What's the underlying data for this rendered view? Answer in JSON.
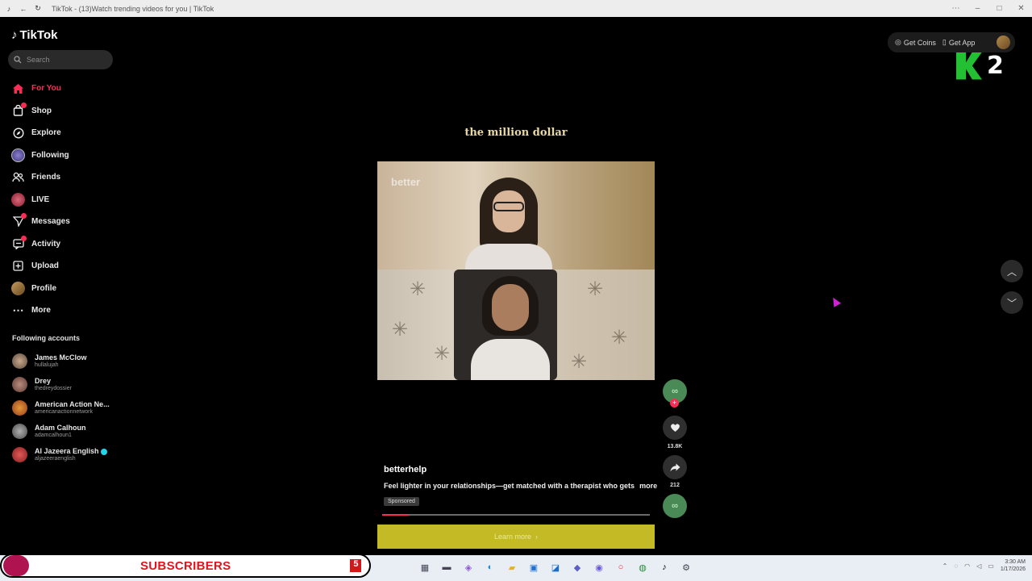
{
  "browser": {
    "title": "TikTok - (13)Watch trending videos for you | TikTok"
  },
  "sidebar": {
    "logo": "TikTok",
    "search_placeholder": "Search",
    "nav": [
      {
        "label": "For You",
        "icon": "home-icon"
      },
      {
        "label": "Shop",
        "icon": "shopping-bag-icon"
      },
      {
        "label": "Explore",
        "icon": "compass-icon"
      },
      {
        "label": "Following",
        "icon": "avatar-icon"
      },
      {
        "label": "Friends",
        "icon": "friends-icon"
      },
      {
        "label": "LIVE",
        "icon": "live-icon"
      },
      {
        "label": "Messages",
        "icon": "send-icon"
      },
      {
        "label": "Activity",
        "icon": "activity-icon"
      },
      {
        "label": "Upload",
        "icon": "plus-square-icon"
      },
      {
        "label": "Profile",
        "icon": "profile-avatar-icon"
      },
      {
        "label": "More",
        "icon": "ellipsis-icon"
      }
    ],
    "following_title": "Following accounts",
    "accounts": [
      {
        "name": "James McClow",
        "handle": "hullalujah"
      },
      {
        "name": "Drey",
        "handle": "thedreydossier"
      },
      {
        "name": "American Action Ne...",
        "handle": "americanactionnetwork"
      },
      {
        "name": "Adam Calhoun",
        "handle": "adamcalhoun1"
      },
      {
        "name": "Al Jazeera English",
        "handle": "aljazeeraenglish"
      }
    ]
  },
  "header": {
    "get_coins": "Get Coins",
    "get_app": "Get App"
  },
  "overlay": {
    "k2_number": "2"
  },
  "video": {
    "caption_top": "the million dollar",
    "watermark": "better",
    "author": "betterhelp",
    "description": "Feel lighter in your relationships—get matched with a therapist who gets",
    "more": "more",
    "sponsored": "Sponsored",
    "progress_percent": 10,
    "cta": "Learn more",
    "likes": "13.8K",
    "shares": "212"
  },
  "taskbar": {
    "subscribers_label": "SUBSCRIBERS",
    "subscribers_count": "5",
    "time": "3:30 AM",
    "date": "1/17/2026"
  },
  "colors": {
    "accent": "#fe2c55",
    "cta": "#c3ba25",
    "caption": "#e8d9a2"
  }
}
